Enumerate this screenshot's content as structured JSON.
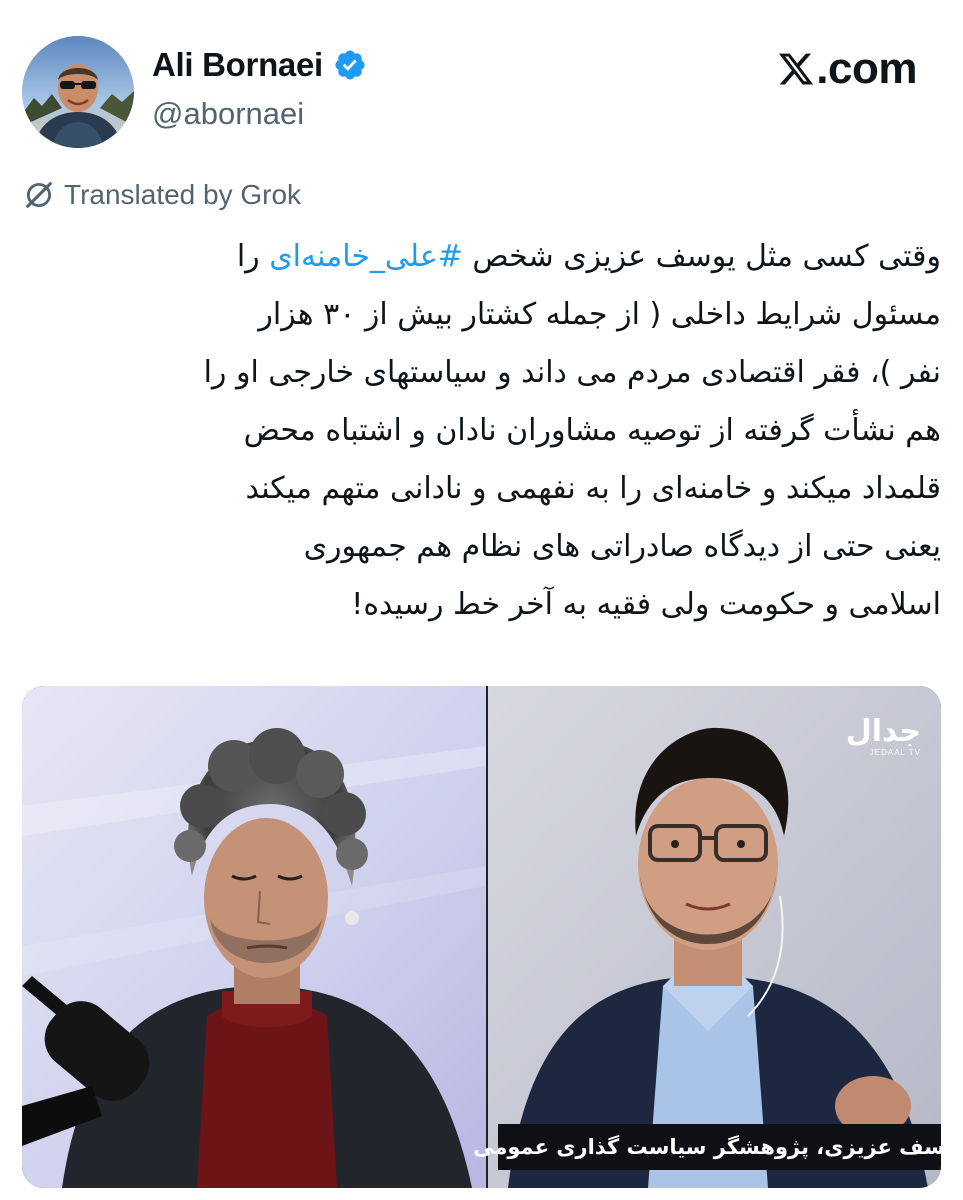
{
  "author": {
    "name": "Ali Bornaei",
    "handle": "@abornaei",
    "verified_color": "#1d9bf0"
  },
  "site": {
    "logo_text": ".com",
    "logo_icon": "x-logo-icon"
  },
  "translation": {
    "label": "Translated by Grok",
    "icon": "grok-icon"
  },
  "tweet": {
    "lines": [
      {
        "before": "وقتی کسی مثل یوسف عزیزی شخص ",
        "hashtag": "#علی_خامنه‌ای",
        "after": " را"
      },
      {
        "text": "مسئول شرایط داخلی ( از جمله کشتار بیش از ۳۰ هزار"
      },
      {
        "text": "نفر )، فقر اقتصادی مردم می داند و سیاستهای خارجی او را"
      },
      {
        "text": "هم نشأت گرفته از توصیه مشاوران نادان و اشتباه محض"
      },
      {
        "text": "قلمداد میکند و خامنه‌ای را به نفهمی و نادانی متهم میکند"
      },
      {
        "text": "یعنی حتی از دیدگاه صادراتی های نظام هم جمهوری"
      },
      {
        "text": "اسلامی و حکومت ولی فقیه به آخر خط رسیده!"
      }
    ],
    "hashtag_color": "#1d9bf0"
  },
  "media": {
    "watermark_logo": "جدال",
    "watermark_sub": "JEDAAL TV",
    "caption": "یوسف عزیزی، پژوهشگر سیاست گذاری عمومی"
  }
}
